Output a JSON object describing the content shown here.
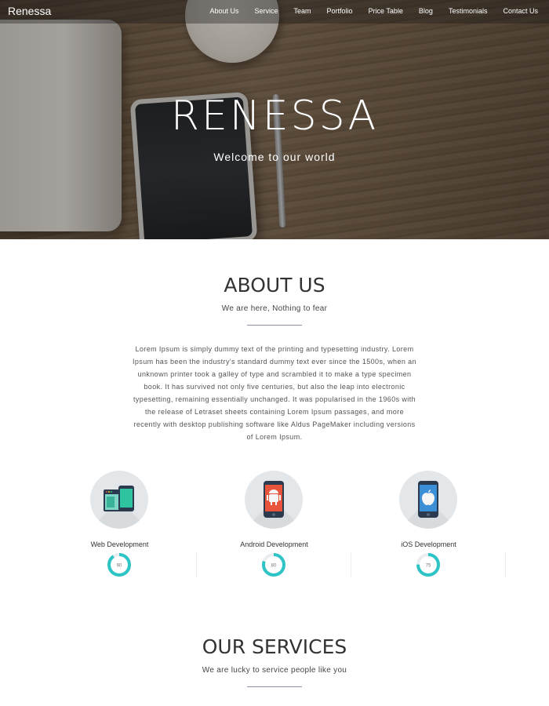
{
  "nav": {
    "brand": "Renessa",
    "items": [
      "About Us",
      "Service",
      "Team",
      "Portfolio",
      "Price Table",
      "Blog",
      "Testimonials",
      "Contact Us"
    ]
  },
  "hero": {
    "title": "RENESSA",
    "subtitle": "Welcome to our world"
  },
  "about": {
    "title": "ABOUT US",
    "subtitle": "We are here, Nothing to fear",
    "lines": [
      "Lorem Ipsum is simply dummy text of the printing and typesetting industry. Lorem",
      "Ipsum has been the industry's standard dummy text ever since the 1500s, when an",
      "unknown printer took a galley of type and scrambled it to make a type specimen",
      "book. It has survived not only five centuries, but also the leap into electronic",
      "typesetting, remaining essentially unchanged. It was popularised in the 1960s with",
      "the release of Letraset sheets containing Lorem Ipsum passages, and more",
      "recently with desktop publishing software like Aldus PageMaker including versions",
      "of Lorem Ipsum."
    ]
  },
  "skills": [
    {
      "label": "Web Development",
      "percent": 90,
      "icon": "web-development-icon"
    },
    {
      "label": "Android Development",
      "percent": 80,
      "icon": "android-phone-icon"
    },
    {
      "label": "iOS Development",
      "percent": 75,
      "icon": "ios-phone-icon"
    }
  ],
  "services": {
    "title": "OUR SERVICES",
    "subtitle": "We are lucky to service people like you"
  },
  "colors": {
    "accent": "#2ec4c6",
    "ring_track": "#e9edef",
    "divider": "#8a8ca8"
  }
}
